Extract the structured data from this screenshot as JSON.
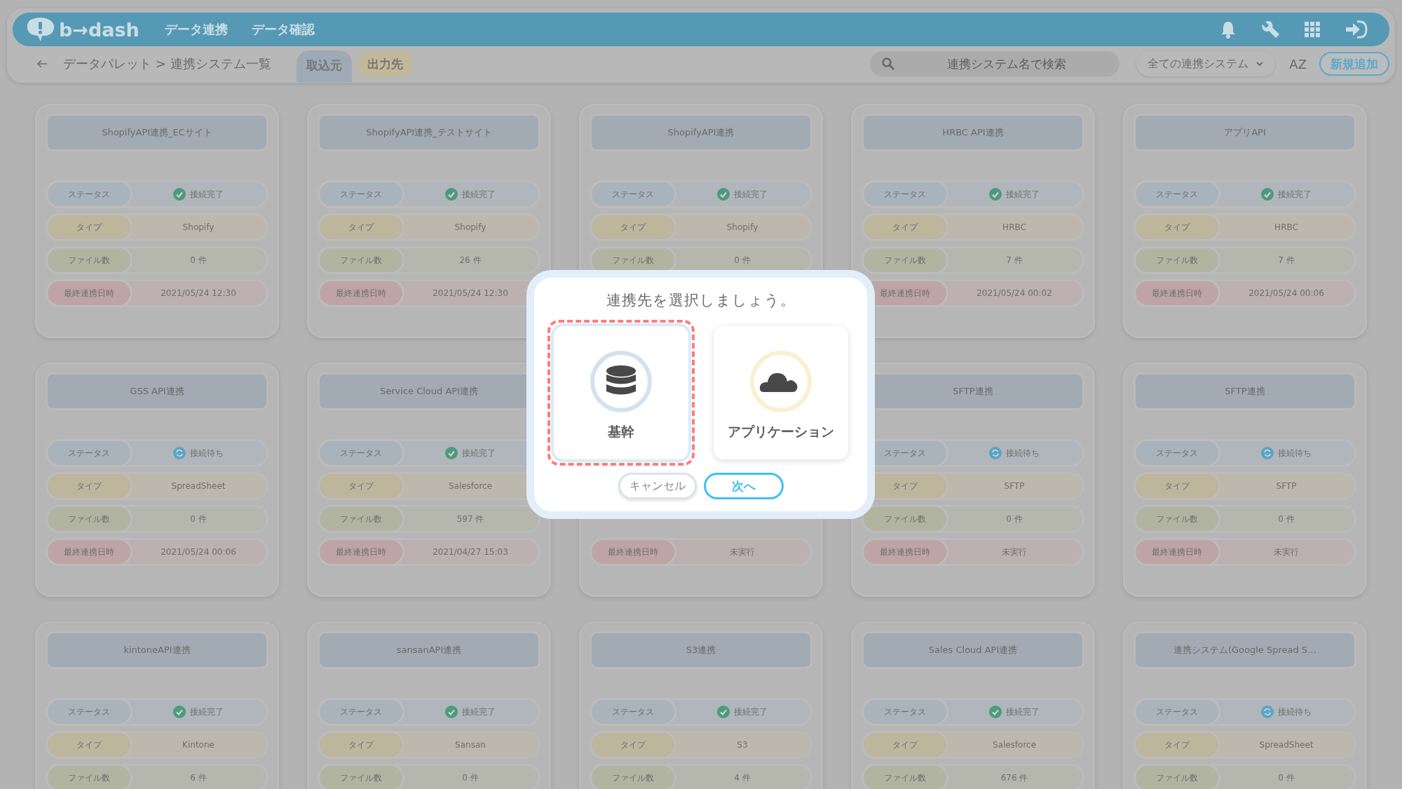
{
  "header": {
    "logo": "b→dash",
    "nav": [
      "データ連携",
      "データ確認"
    ]
  },
  "toolbar": {
    "breadcrumb": "データパレット > 連携システム一覧",
    "tabs": [
      {
        "label": "取込元",
        "selected": true
      },
      {
        "label": "出力先",
        "selected": false
      }
    ],
    "search": {
      "placeholder": "連携システム名で検索"
    },
    "filter": "全ての連携システム",
    "sort": "AZ",
    "add_button": "新規追加"
  },
  "cards": [
    {
      "title": "ShopifyAPI連携_ECサイト",
      "fields": [
        {
          "kind": "status",
          "label": "ステータス",
          "value": "接続完了",
          "connected": true
        },
        {
          "kind": "type",
          "label": "タイプ",
          "value": "Shopify"
        },
        {
          "kind": "files",
          "label": "ファイル数",
          "value": "0 件"
        },
        {
          "kind": "last",
          "label": "最終連携日時",
          "value": "2021/05/24 12:30"
        }
      ]
    },
    {
      "title": "ShopifyAPI連携_テストサイト",
      "fields": [
        {
          "kind": "status",
          "label": "ステータス",
          "value": "接続完了",
          "connected": true
        },
        {
          "kind": "type",
          "label": "タイプ",
          "value": "Shopify"
        },
        {
          "kind": "files",
          "label": "ファイル数",
          "value": "26 件"
        },
        {
          "kind": "last",
          "label": "最終連携日時",
          "value": "2021/05/24 12:30"
        }
      ]
    },
    {
      "title": "ShopifyAPI連携",
      "fields": [
        {
          "kind": "status",
          "label": "ステータス",
          "value": "接続完了",
          "connected": true
        },
        {
          "kind": "type",
          "label": "タイプ",
          "value": "Shopify"
        },
        {
          "kind": "files",
          "label": "ファイル数",
          "value": "0 件"
        }
      ]
    },
    {
      "title": "HRBC API連携",
      "fields": [
        {
          "kind": "status",
          "label": "ステータス",
          "value": "接続完了",
          "connected": true
        },
        {
          "kind": "type",
          "label": "タイプ",
          "value": "HRBC"
        },
        {
          "kind": "files",
          "label": "ファイル数",
          "value": "7 件"
        },
        {
          "kind": "last",
          "label": "最終連携日時",
          "value": "2021/05/24 00:02"
        }
      ]
    },
    {
      "title": "アプリAPI",
      "fields": [
        {
          "kind": "status",
          "label": "ステータス",
          "value": "接続完了",
          "connected": true
        },
        {
          "kind": "type",
          "label": "タイプ",
          "value": "HRBC"
        },
        {
          "kind": "files",
          "label": "ファイル数",
          "value": "7 件"
        },
        {
          "kind": "last",
          "label": "最終連携日時",
          "value": "2021/05/24 00:06"
        }
      ]
    },
    {
      "title": "GSS API連携",
      "fields": [
        {
          "kind": "status",
          "label": "ステータス",
          "value": "接続待ち",
          "connected": false
        },
        {
          "kind": "type",
          "label": "タイプ",
          "value": "SpreadSheet"
        },
        {
          "kind": "files",
          "label": "ファイル数",
          "value": "0 件"
        },
        {
          "kind": "last",
          "label": "最終連携日時",
          "value": "2021/05/24 00:06"
        }
      ]
    },
    {
      "title": "Service Cloud API連携",
      "fields": [
        {
          "kind": "status",
          "label": "ステータス",
          "value": "接続完了",
          "connected": true
        },
        {
          "kind": "type",
          "label": "タイプ",
          "value": "Salesforce"
        },
        {
          "kind": "files",
          "label": "ファイル数",
          "value": "597 件"
        },
        {
          "kind": "last",
          "label": "最終連携日時",
          "value": "2021/04/27 15:03"
        }
      ]
    },
    {
      "fields": [
        {
          "kind": "last",
          "label": "最終連携日時",
          "value": "未実行"
        }
      ]
    },
    {
      "title": "SFTP連携",
      "fields": [
        {
          "kind": "status",
          "label": "ステータス",
          "value": "接続待ち",
          "connected": false
        },
        {
          "kind": "type",
          "label": "タイプ",
          "value": "SFTP"
        },
        {
          "kind": "files",
          "label": "ファイル数",
          "value": "0 件"
        },
        {
          "kind": "last",
          "label": "最終連携日時",
          "value": "未実行"
        }
      ]
    },
    {
      "title": "SFTP連携",
      "fields": [
        {
          "kind": "status",
          "label": "ステータス",
          "value": "接続待ち",
          "connected": false
        },
        {
          "kind": "type",
          "label": "タイプ",
          "value": "SFTP"
        },
        {
          "kind": "files",
          "label": "ファイル数",
          "value": "0 件"
        },
        {
          "kind": "last",
          "label": "最終連携日時",
          "value": "未実行"
        }
      ]
    },
    {
      "title": "kintoneAPI連携",
      "fields": [
        {
          "kind": "status",
          "label": "ステータス",
          "value": "接続完了",
          "connected": true
        },
        {
          "kind": "type",
          "label": "タイプ",
          "value": "Kintone"
        },
        {
          "kind": "files",
          "label": "ファイル数",
          "value": "6 件"
        }
      ]
    },
    {
      "title": "sansanAPI連携",
      "fields": [
        {
          "kind": "status",
          "label": "ステータス",
          "value": "接続完了",
          "connected": true
        },
        {
          "kind": "type",
          "label": "タイプ",
          "value": "Sansan"
        },
        {
          "kind": "files",
          "label": "ファイル数",
          "value": "0 件"
        }
      ]
    },
    {
      "title": "S3連携",
      "fields": [
        {
          "kind": "status",
          "label": "ステータス",
          "value": "接続完了",
          "connected": true
        },
        {
          "kind": "type",
          "label": "タイプ",
          "value": "S3"
        },
        {
          "kind": "files",
          "label": "ファイル数",
          "value": "4 件"
        }
      ]
    },
    {
      "title": "Sales Cloud API連携",
      "fields": [
        {
          "kind": "status",
          "label": "ステータス",
          "value": "接続完了",
          "connected": true
        },
        {
          "kind": "type",
          "label": "タイプ",
          "value": "Salesforce"
        },
        {
          "kind": "files",
          "label": "ファイル数",
          "value": "676 件"
        }
      ]
    },
    {
      "title": "連携システム(Google Spread S…",
      "fields": [
        {
          "kind": "status",
          "label": "ステータス",
          "value": "接続待ち",
          "connected": false
        },
        {
          "kind": "type",
          "label": "タイプ",
          "value": "SpreadSheet"
        },
        {
          "kind": "files",
          "label": "ファイル数",
          "value": "0 件"
        }
      ]
    }
  ],
  "dialog": {
    "title": "連携先を選択しましょう。",
    "options": [
      {
        "kind": "database",
        "label": "基幹",
        "selected": true
      },
      {
        "kind": "cloud",
        "label": "アプリケーション",
        "selected": false
      }
    ],
    "cancel": "キャンセル",
    "next": "次へ"
  }
}
